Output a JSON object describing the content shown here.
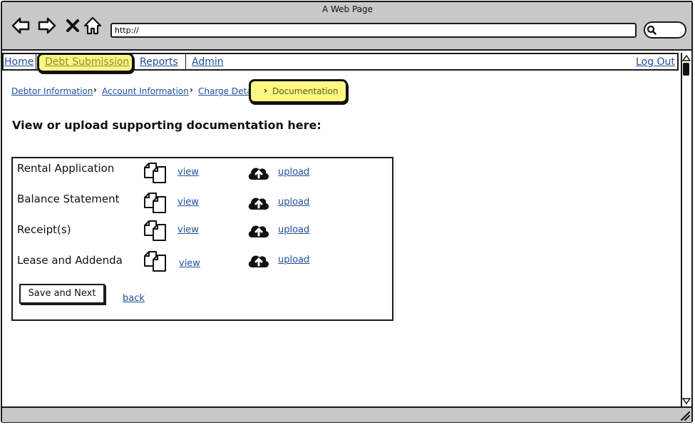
{
  "window": {
    "title": "A Web Page"
  },
  "browser": {
    "url": "http://"
  },
  "nav": {
    "items": [
      {
        "label": "Home"
      },
      {
        "label": "Debt Submission"
      },
      {
        "label": "Reports"
      },
      {
        "label": "Admin"
      }
    ],
    "logout": "Log Out"
  },
  "breadcrumb": {
    "items": [
      {
        "label": "Debtor Information"
      },
      {
        "label": "Account Information"
      },
      {
        "label": "Charge Details"
      },
      {
        "label": "Documentation"
      }
    ]
  },
  "main": {
    "heading": "View or upload supporting documentation here:",
    "documents": [
      {
        "label": "Rental Application",
        "view": "view",
        "upload": "upload"
      },
      {
        "label": "Balance Statement",
        "view": "view",
        "upload": "upload"
      },
      {
        "label": "Receipt(s)",
        "view": "view",
        "upload": "upload"
      },
      {
        "label": "Lease and Addenda",
        "view": "view",
        "upload": "upload"
      }
    ],
    "save_label": "Save and Next",
    "back_label": "back"
  },
  "icons": {
    "nav": [
      "back-arrow-icon",
      "forward-arrow-icon",
      "close-icon",
      "home-icon",
      "search-icon"
    ],
    "document": "documents-icon",
    "upload": "cloud-upload-icon"
  },
  "colors": {
    "highlight": "#fbf883",
    "link": "#1f4f9c",
    "chrome": "#c8c8c8"
  }
}
